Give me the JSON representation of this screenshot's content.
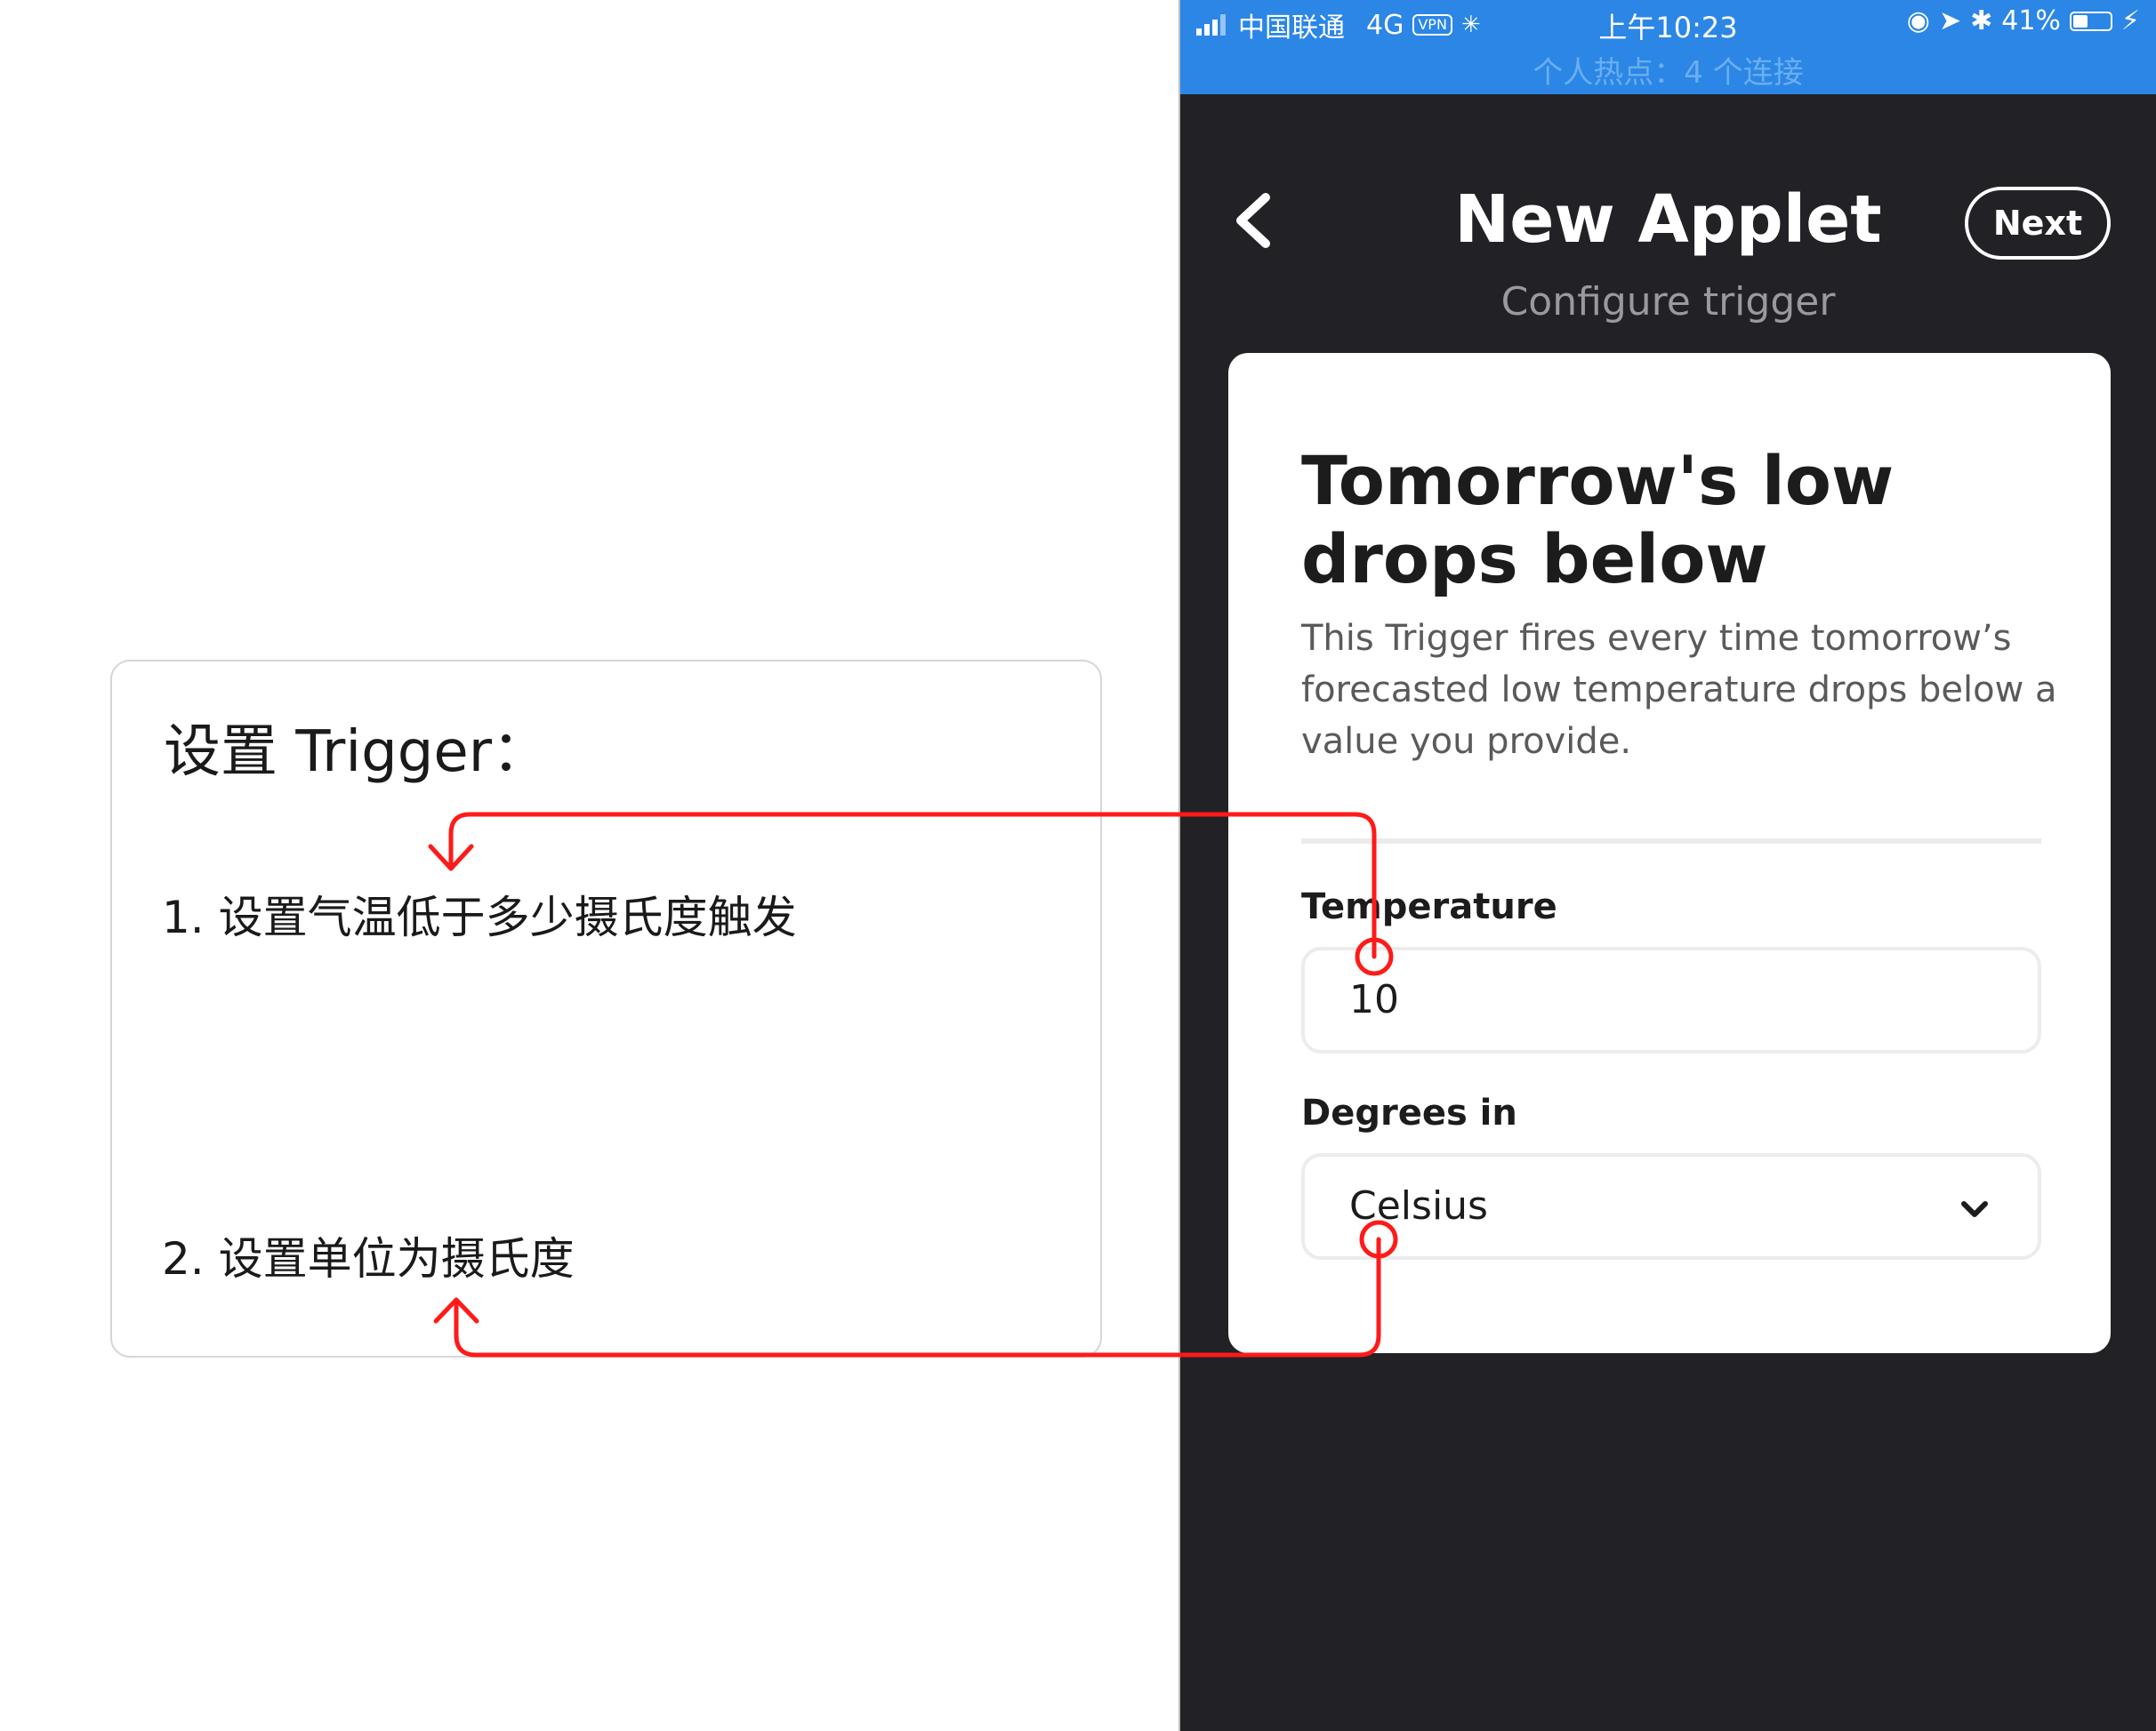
{
  "annotation": {
    "title": "设置 Trigger：",
    "step1": "1. 设置气温低于多少摄氏度触发",
    "step2": "2. 设置单位为摄氏度"
  },
  "status_bar": {
    "carrier": "中国联通",
    "network": "4G",
    "vpn": "VPN",
    "time": "上午10:23",
    "battery": "41%",
    "battery_level": 0.41,
    "hotspot": "个人热点：4 个连接"
  },
  "header": {
    "title": "New Applet",
    "subtitle": "Configure trigger",
    "next_label": "Next"
  },
  "trigger": {
    "title": "Tomorrow's low drops below",
    "description": "This Trigger fires every time tomorrow’s forecasted low temperature drops below a value you provide.",
    "temperature_label": "Temperature",
    "temperature_value": "10",
    "degrees_label": "Degrees in",
    "degrees_value": "Celsius"
  },
  "colors": {
    "status_bar": "#2b86e6",
    "background": "#222226",
    "annotation_line": "#ff1a1a"
  }
}
